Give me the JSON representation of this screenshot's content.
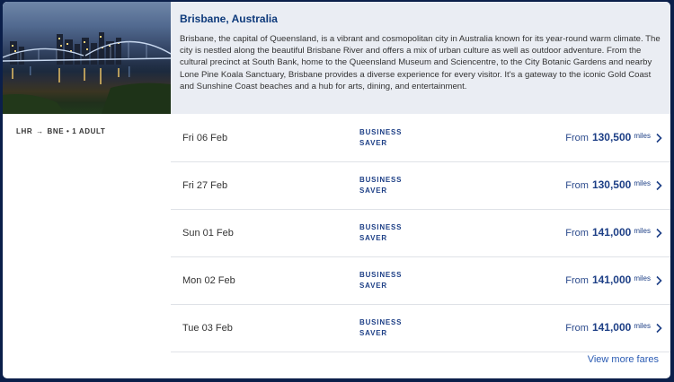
{
  "destination": {
    "title": "Brisbane, Australia",
    "description": "Brisbane, the capital of Queensland, is a vibrant and cosmopolitan city in Australia known for its year-round warm climate. The city is nestled along the beautiful Brisbane River and offers a mix of urban culture as well as outdoor adventure. From the cultural precinct at South Bank, home to the Queensland Museum and Sciencentre, to the City Botanic Gardens and nearby Lone Pine Koala Sanctuary, Brisbane provides a diverse experience for every visitor. It's a gateway to the iconic Gold Coast and Sunshine Coast beaches and a hub for arts, dining, and entertainment."
  },
  "route": {
    "origin": "LHR",
    "arrow": "→",
    "destination": "BNE",
    "separator": "•",
    "passengers": "1 ADULT"
  },
  "fares": [
    {
      "date": "Fri 06 Feb",
      "cabin_line1": "BUSINESS",
      "cabin_line2": "SAVER",
      "from": "From",
      "amount": "130,500",
      "unit": "miles"
    },
    {
      "date": "Fri 27 Feb",
      "cabin_line1": "BUSINESS",
      "cabin_line2": "SAVER",
      "from": "From",
      "amount": "130,500",
      "unit": "miles"
    },
    {
      "date": "Sun 01 Feb",
      "cabin_line1": "BUSINESS",
      "cabin_line2": "SAVER",
      "from": "From",
      "amount": "141,000",
      "unit": "miles"
    },
    {
      "date": "Mon 02 Feb",
      "cabin_line1": "BUSINESS",
      "cabin_line2": "SAVER",
      "from": "From",
      "amount": "141,000",
      "unit": "miles"
    },
    {
      "date": "Tue 03 Feb",
      "cabin_line1": "BUSINESS",
      "cabin_line2": "SAVER",
      "from": "From",
      "amount": "141,000",
      "unit": "miles"
    }
  ],
  "view_more_label": "View more fares",
  "colors": {
    "page_background": "#0b1f4a",
    "header_background": "#eaedf3",
    "brand_navy": "#1d3f86",
    "link_blue": "#2a5bb3"
  },
  "icons": {
    "row_chevron": "chevron-right-icon",
    "photo": "brisbane-skyline-photo"
  }
}
